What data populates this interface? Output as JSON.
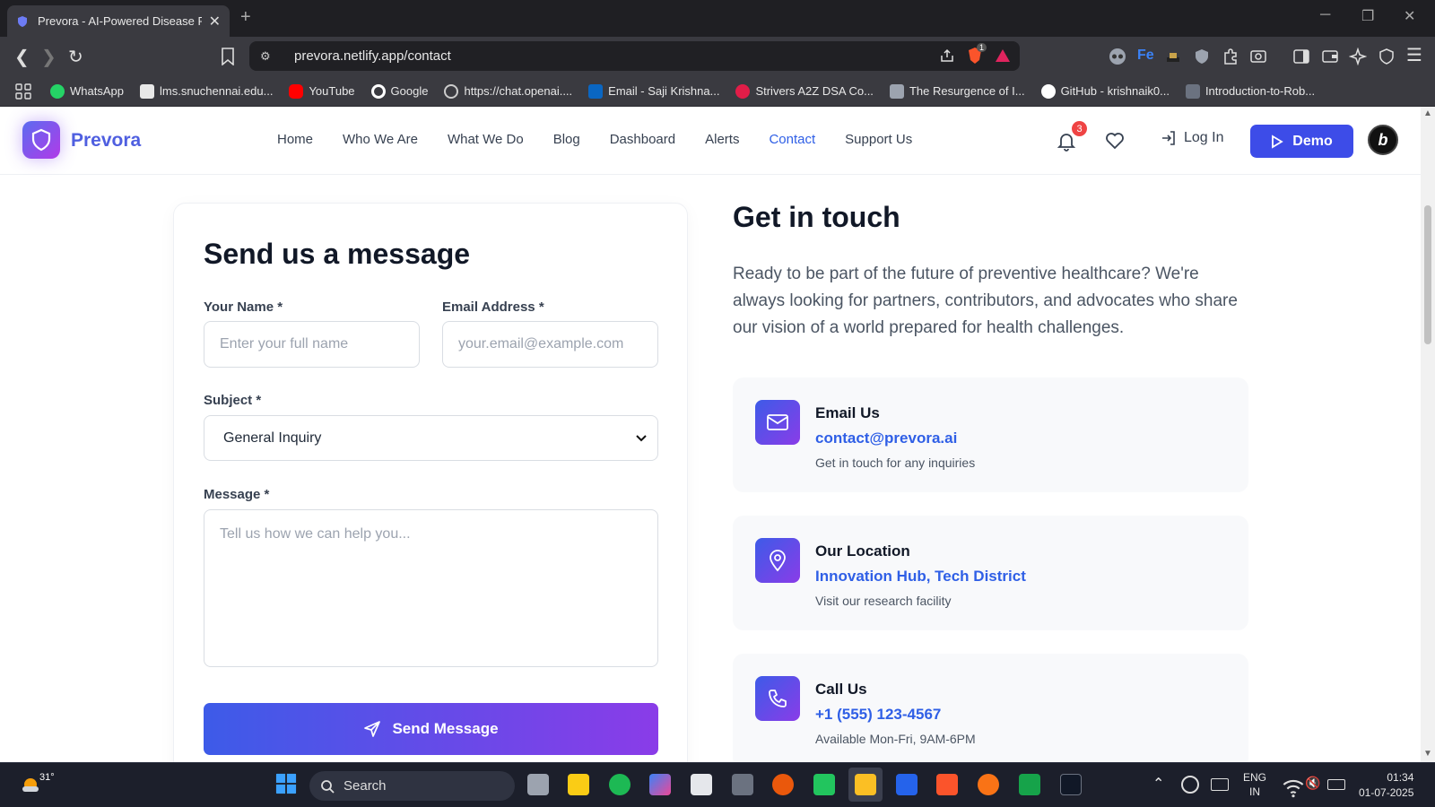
{
  "browser": {
    "tab_title": "Prevora - AI-Powered Disease Pr",
    "tab_close": "✕",
    "new_tab": "+",
    "url": "prevora.netlify.app/contact",
    "brave_count": "1",
    "bookmarks": [
      {
        "label": "WhatsApp",
        "color": "#25d366"
      },
      {
        "label": "lms.snuchennai.edu...",
        "color": "#e8e8e8"
      },
      {
        "label": "YouTube",
        "color": "#ff0000"
      },
      {
        "label": "Google",
        "color": "#ffffff"
      },
      {
        "label": "https://chat.openai....",
        "color": "#cccccc"
      },
      {
        "label": "Email - Saji Krishna...",
        "color": "#0a66c2"
      },
      {
        "label": "Strivers A2Z DSA Co...",
        "color": "#e11d48"
      },
      {
        "label": "The Resurgence of I...",
        "color": "#9ca3af"
      },
      {
        "label": "GitHub - krishnaik0...",
        "color": "#ffffff"
      },
      {
        "label": "Introduction-to-Rob...",
        "color": "#6b7280"
      }
    ]
  },
  "site": {
    "brand": "Prevora",
    "menu": [
      {
        "label": "Home",
        "active": false
      },
      {
        "label": "Who We Are",
        "active": false
      },
      {
        "label": "What We Do",
        "active": false
      },
      {
        "label": "Blog",
        "active": false
      },
      {
        "label": "Dashboard",
        "active": false
      },
      {
        "label": "Alerts",
        "active": false
      },
      {
        "label": "Contact",
        "active": true
      },
      {
        "label": "Support Us",
        "active": false
      }
    ],
    "notification_count": "3",
    "login_label": "Log In",
    "demo_label": "Demo",
    "avatar_letter": "b",
    "accent": "#2f5fe6"
  },
  "form": {
    "title": "Send us a message",
    "name_label": "Your Name *",
    "name_placeholder": "Enter your full name",
    "email_label": "Email Address *",
    "email_placeholder": "your.email@example.com",
    "subject_label": "Subject *",
    "subject_value": "General Inquiry",
    "message_label": "Message *",
    "message_placeholder": "Tell us how we can help you...",
    "send_label": "Send Message"
  },
  "contact": {
    "title": "Get in touch",
    "description": "Ready to be part of the future of preventive healthcare? We're always looking for partners, contributors, and advocates who share our vision of a world prepared for health challenges.",
    "cards": [
      {
        "title": "Email Us",
        "value": "contact@prevora.ai",
        "sub": "Get in touch for any inquiries",
        "icon": "mail-icon"
      },
      {
        "title": "Our Location",
        "value": "Innovation Hub, Tech District",
        "sub": "Visit our research facility",
        "icon": "location-pin-icon"
      },
      {
        "title": "Call Us",
        "value": "+1 (555) 123-4567",
        "sub": "Available Mon-Fri, 9AM-6PM",
        "icon": "phone-icon"
      }
    ]
  },
  "taskbar": {
    "weather": "31°",
    "search_label": "Search",
    "lang_line1": "ENG",
    "lang_line2": "IN",
    "time": "01:34",
    "date": "01-07-2025"
  }
}
